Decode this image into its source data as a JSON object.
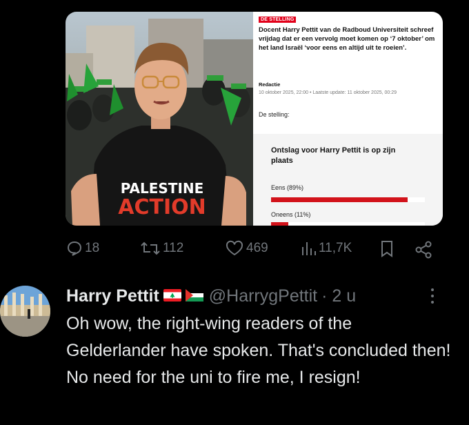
{
  "article": {
    "tag": "DE STELLING",
    "headline": "Docent Harry Pettit van de Radboud Universiteit schreef vrijdag dat er een vervolg moet komen op ‘7 oktober’ om het land Israël ‘voor eens en altijd uit te roeien’.",
    "author": "Redactie",
    "dates": "10 oktober 2025, 22:00 • Laatste update: 11 oktober 2025, 00:29",
    "stelling_label": "De stelling:",
    "poll_question": "Ontslag voor Harry Pettit is op zijn plaats",
    "options": [
      {
        "label": "Eens (89%)",
        "fraction": 0.89
      },
      {
        "label": "Oneens (11%)",
        "fraction": 0.11
      }
    ],
    "bar_color": "#d2121a"
  },
  "photo": {
    "shirt_line1": "PALESTINE",
    "shirt_line2": "ACTION"
  },
  "actions": {
    "replies": "18",
    "reposts": "112",
    "likes": "469",
    "views": "11,7K"
  },
  "reply": {
    "display_name": "Harry Pettit",
    "handle": "@HarrygPettit",
    "time": "· 2 u",
    "text": "Oh wow, the right-wing readers of the Gelderlander have spoken. That's concluded then! No need for the uni to fire me, I resign!",
    "flags": [
      "lebanon-flag",
      "palestine-flag"
    ]
  },
  "colors": {
    "background": "#000000",
    "text": "#e7e9ea",
    "muted": "#71767b",
    "accent_red": "#e2001a"
  }
}
